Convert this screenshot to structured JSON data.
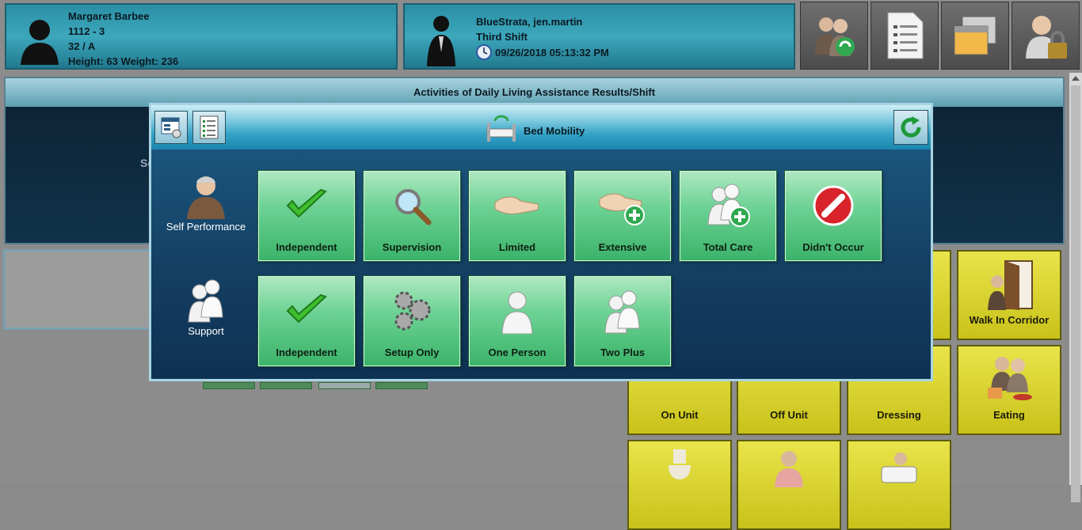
{
  "resident": {
    "name": "Margaret Barbee",
    "room": "1112 - 3",
    "age_bed": "32 / A",
    "height_weight": "Height: 63 Weight: 236"
  },
  "staff": {
    "name": "BlueStrata, jen.martin",
    "shift": "Third Shift",
    "datetime": "09/26/2018 05:13:32 PM"
  },
  "header_buttons": [
    "residents-icon",
    "checklist-icon",
    "windows-icon",
    "user-lock-icon"
  ],
  "background_dialog": {
    "title": "Activities of Daily Living Assistance Results/Shift",
    "partial_text": "Se"
  },
  "yellow_tiles": [
    {
      "label": "n",
      "icon": "person-icon"
    },
    {
      "label": "Walk In Corridor",
      "icon": "door-walk-icon"
    },
    {
      "label": "On Unit",
      "icon": "on-unit-icon"
    },
    {
      "label": "Off Unit",
      "icon": "off-unit-icon"
    },
    {
      "label": "Dressing",
      "icon": "dressing-icon"
    },
    {
      "label": "Eating",
      "icon": "eating-icon"
    },
    {
      "label": "",
      "icon": "toilet-icon"
    },
    {
      "label": "",
      "icon": "person-hygiene-icon"
    },
    {
      "label": "",
      "icon": "bathtub-icon"
    }
  ],
  "modal": {
    "title": "Bed Mobility",
    "self_performance": {
      "label": "Self Performance",
      "options": [
        {
          "label": "Independent",
          "icon": "checkmark-icon"
        },
        {
          "label": "Supervision",
          "icon": "magnifier-icon"
        },
        {
          "label": "Limited",
          "icon": "hands-icon"
        },
        {
          "label": "Extensive",
          "icon": "hand-plus-icon"
        },
        {
          "label": "Total Care",
          "icon": "people-plus-icon"
        },
        {
          "label": "Didn't Occur",
          "icon": "no-entry-icon"
        }
      ]
    },
    "support": {
      "label": "Support",
      "options": [
        {
          "label": "Independent",
          "icon": "checkmark-icon"
        },
        {
          "label": "Setup Only",
          "icon": "gears-icon"
        },
        {
          "label": "One Person",
          "icon": "one-person-icon"
        },
        {
          "label": "Two Plus",
          "icon": "two-people-icon"
        }
      ]
    }
  },
  "colors": {
    "header_teal": "#2a8fa4",
    "modal_blue": "#1e5d86",
    "tile_green": "#6dd294",
    "tile_yellow": "#e9e44a"
  }
}
